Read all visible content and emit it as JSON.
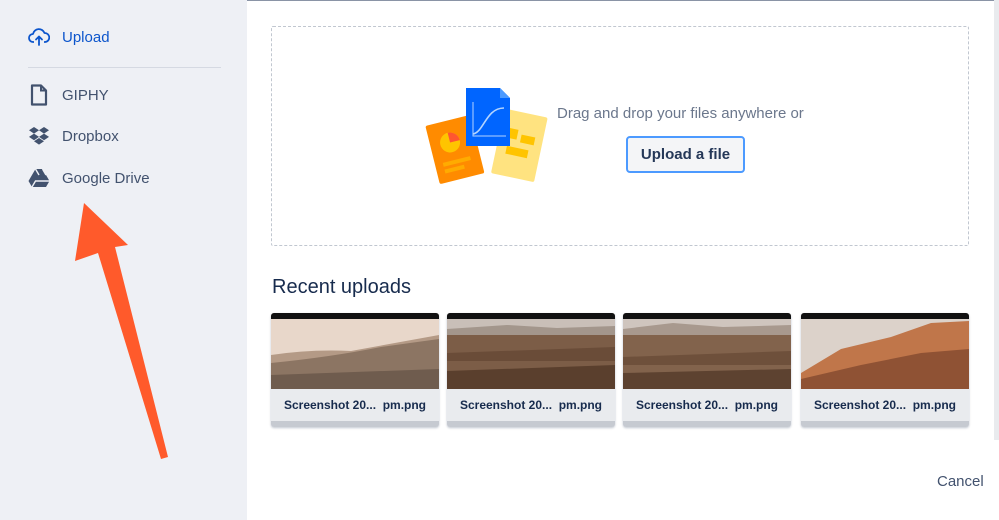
{
  "sidebar": {
    "items": [
      {
        "label": "Upload",
        "icon": "cloud-upload-icon",
        "active": true
      },
      {
        "label": "GIPHY",
        "icon": "giphy-icon"
      },
      {
        "label": "Dropbox",
        "icon": "dropbox-icon"
      },
      {
        "label": "Google Drive",
        "icon": "google-drive-icon"
      }
    ]
  },
  "dropzone": {
    "text": "Drag and drop your files anywhere or",
    "button_label": "Upload a file",
    "illustration": "documents-illustration"
  },
  "recent": {
    "title": "Recent uploads",
    "items": [
      {
        "caption": "Screenshot 20...  pm.png"
      },
      {
        "caption": "Screenshot 20...  pm.png"
      },
      {
        "caption": "Screenshot 20...  pm.png"
      },
      {
        "caption": "Screenshot 20...  pm.png"
      }
    ]
  },
  "footer": {
    "cancel_label": "Cancel"
  },
  "colors": {
    "accent": "#0c55cc",
    "sidebar_bg": "#eef0f5",
    "button_border": "#4c9aff",
    "annotation_arrow": "#ff5a2b"
  }
}
